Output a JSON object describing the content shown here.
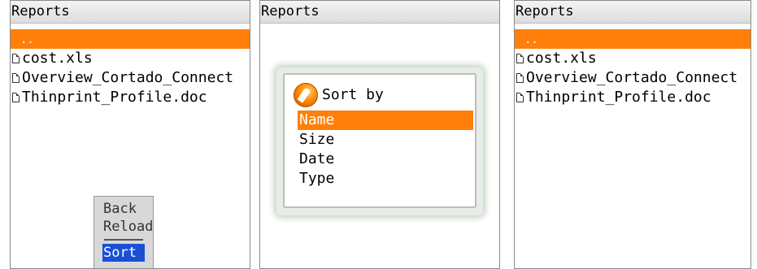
{
  "panels": [
    {
      "title": "Reports",
      "parent_entry": "..",
      "files": [
        "cost.xls",
        "Overview_Cortado_Connect",
        "Thinprint_Profile.doc"
      ],
      "menu": {
        "items": [
          "Back",
          "Reload",
          "Sort"
        ],
        "selected": "Sort"
      }
    },
    {
      "title": "Reports",
      "sort_dialog": {
        "title": "Sort by",
        "options": [
          "Name",
          "Size",
          "Date",
          "Type"
        ],
        "selected": "Name"
      }
    },
    {
      "title": "Reports",
      "parent_entry": "..",
      "files": [
        "cost.xls",
        "Overview_Cortado_Connect",
        "Thinprint_Profile.doc"
      ]
    }
  ],
  "colors": {
    "selection_orange": "#ff7f0a",
    "menu_selection_blue": "#1a4fd6"
  }
}
